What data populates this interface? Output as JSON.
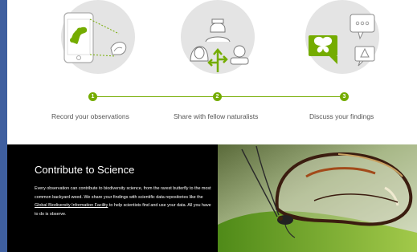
{
  "steps": [
    {
      "number": "1",
      "label": "Record your observations",
      "icon": "phone-caterpillar-icon"
    },
    {
      "number": "2",
      "label": "Share with fellow naturalists",
      "icon": "people-share-icon"
    },
    {
      "number": "3",
      "label": "Discuss your findings",
      "icon": "chat-butterfly-icon"
    }
  ],
  "colors": {
    "accent": "#74ac00",
    "circle": "#e4e4e4",
    "dark": "#000000",
    "page_edge": "#3f5f9f"
  },
  "science": {
    "title": "Contribute to Science",
    "body_before": "Every observation can contribute to biodiversity science, from the rarest butterfly to the most common backyard weed. We share your findings with scientific data repositories like the ",
    "link_text": "Global Biodiversity Information Facility",
    "body_after": " to help scientists find and use your data. All you have to do is observe.",
    "photo_icon": "glasswing-butterfly-photo"
  }
}
